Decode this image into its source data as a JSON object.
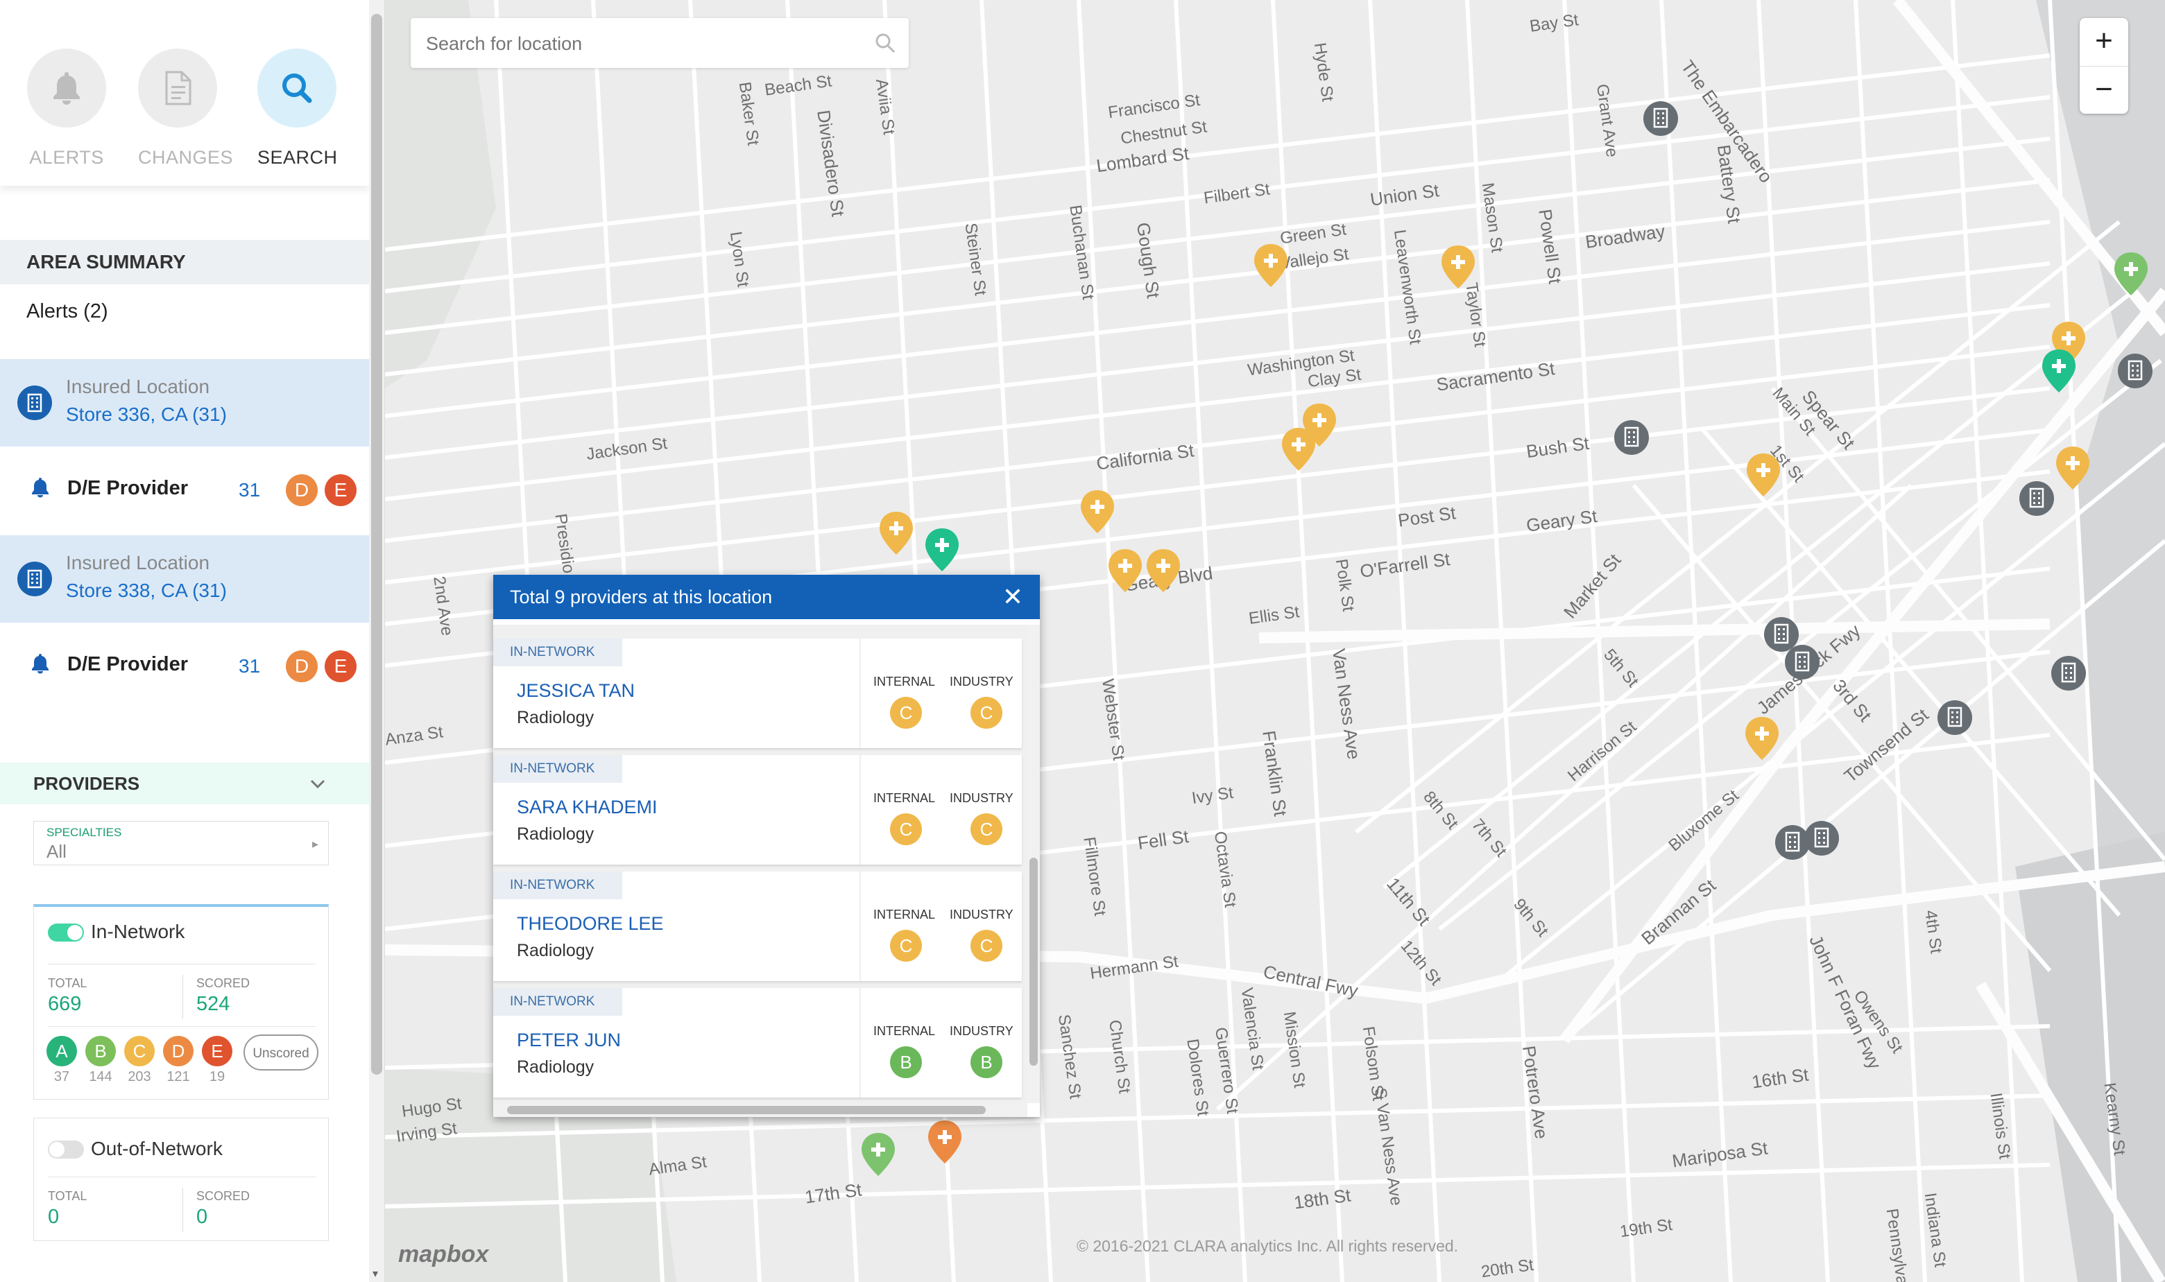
{
  "nav": {
    "alerts_label": "ALERTS",
    "changes_label": "CHANGES",
    "search_label": "SEARCH"
  },
  "area_summary": {
    "title": "AREA SUMMARY",
    "alerts": "Alerts (2)",
    "locations": [
      {
        "type_label": "Insured Location",
        "name": "Store 336, CA (31)",
        "provider_label": "D/E Provider",
        "count": "31",
        "grades": [
          "D",
          "E"
        ]
      },
      {
        "type_label": "Insured Location",
        "name": "Store 338, CA (31)",
        "provider_label": "D/E Provider",
        "count": "31",
        "grades": [
          "D",
          "E"
        ]
      }
    ]
  },
  "providers": {
    "title": "PROVIDERS",
    "specialties_label": "SPECIALTIES",
    "specialties_value": "All",
    "in_network": {
      "title": "In-Network",
      "toggle_on": true,
      "total_label": "TOTAL",
      "total": "669",
      "scored_label": "SCORED",
      "scored": "524",
      "grades": [
        {
          "grade": "A",
          "count": "37",
          "color": "#27b37a"
        },
        {
          "grade": "B",
          "count": "144",
          "color": "#7dbf5a"
        },
        {
          "grade": "C",
          "count": "203",
          "color": "#f0b84a"
        },
        {
          "grade": "D",
          "count": "121",
          "color": "#ec8a43"
        },
        {
          "grade": "E",
          "count": "19",
          "color": "#e0532f"
        }
      ],
      "unscored_label": "Unscored"
    },
    "out_network": {
      "title": "Out-of-Network",
      "toggle_on": false,
      "total_label": "TOTAL",
      "total": "0",
      "scored_label": "SCORED",
      "scored": "0"
    }
  },
  "map": {
    "search_placeholder": "Search for location",
    "zoom_in": "+",
    "zoom_out": "−",
    "attribution_logo": "mapbox",
    "copyright": "© 2016-2021 CLARA analytics Inc. All rights reserved.",
    "street_labels": [
      "Bay St",
      "Beach St",
      "Francisco St",
      "Chestnut St",
      "Lombard St",
      "Filbert St",
      "Union St",
      "Green St",
      "Vallejo St",
      "Broadway",
      "Washington St",
      "Clay St",
      "Sacramento St",
      "California St",
      "Bush St",
      "Post St",
      "Geary St",
      "O'Farrell St",
      "Geary Blvd",
      "Ellis St",
      "Jackson St",
      "Ivy St",
      "Fell St",
      "Hermann St",
      "Central Fwy",
      "Alma St",
      "17th St",
      "16th St",
      "18th St",
      "19th St",
      "20th St",
      "Mariposa St",
      "Market St",
      "Hyde St",
      "Polk St",
      "Van Ness Ave",
      "Franklin St",
      "Octavia St",
      "Gough St",
      "Webster St",
      "Fillmore St",
      "Buchanan St",
      "Steiner St",
      "Divisadero St",
      "Baker St",
      "Lyon St",
      "Leavenworth St",
      "Taylor St",
      "Mason St",
      "Powell St",
      "Grant Ave",
      "Battery St",
      "The Embarcadero",
      "Main St",
      "Spear St",
      "1st St",
      "5th St",
      "3rd St",
      "7th St",
      "8th St",
      "9th St",
      "11th St",
      "12th St",
      "Harrison St",
      "Bluxome St",
      "Townsend St",
      "Brannan St",
      "James Lick Fwy",
      "Valencia St",
      "Mission St",
      "Folsom St",
      "Potrero Ave",
      "Church St",
      "Dolores St",
      "Guerrero St",
      "Sanchez St",
      "Hugo St",
      "Irving St",
      "2nd Ave",
      "Anza St",
      "Owens St",
      "John F Foran Fwy",
      "Illinois St",
      "Indiana St",
      "Pennsylvania",
      "4th St",
      "Aviia St",
      "Presidio",
      "S Van Ness Ave",
      "Kearny St"
    ]
  },
  "popup": {
    "title": "Total 9 providers at this location",
    "internal_label": "INTERNAL",
    "industry_label": "INDUSTRY",
    "providers": [
      {
        "badge": "IN-NETWORK",
        "name": "JESSICA TAN",
        "specialty": "Radiology",
        "internal": "C",
        "industry": "C",
        "internal_color": "#f0b84a",
        "industry_color": "#f0b84a"
      },
      {
        "badge": "IN-NETWORK",
        "name": "SARA KHADEMI",
        "specialty": "Radiology",
        "internal": "C",
        "industry": "C",
        "internal_color": "#f0b84a",
        "industry_color": "#f0b84a"
      },
      {
        "badge": "IN-NETWORK",
        "name": "THEODORE LEE",
        "specialty": "Radiology",
        "internal": "C",
        "industry": "C",
        "internal_color": "#f0b84a",
        "industry_color": "#f0b84a"
      },
      {
        "badge": "IN-NETWORK",
        "name": "PETER JUN",
        "specialty": "Radiology",
        "internal": "B",
        "industry": "B",
        "internal_color": "#6ab85a",
        "industry_color": "#6ab85a"
      }
    ]
  },
  "colors": {
    "grade_c": "#f0b84a",
    "grade_b": "#7dc36d",
    "grade_a_pin": "#20c08d",
    "grade_d": "#ec8a43",
    "building": "#666d73",
    "header_blue": "#1261b7"
  }
}
